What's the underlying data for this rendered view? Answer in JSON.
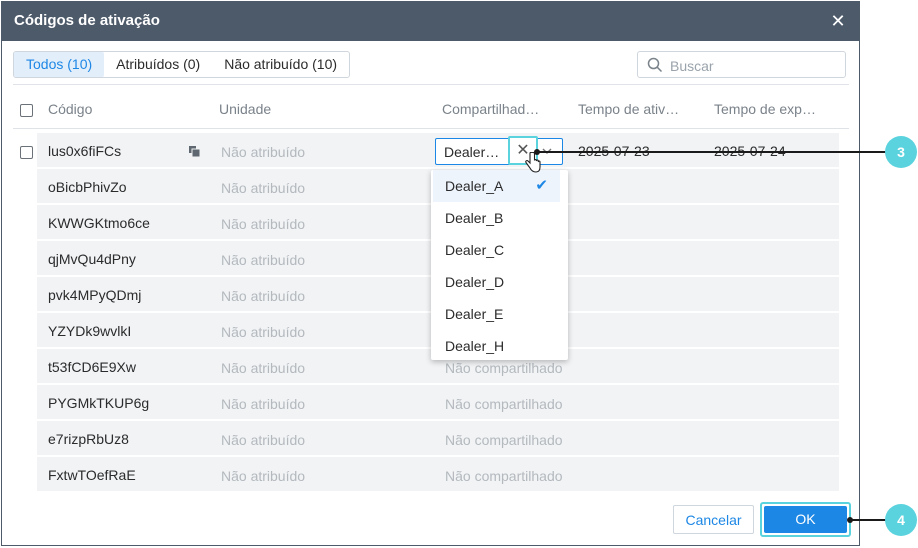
{
  "dialog": {
    "title": "Códigos de ativação"
  },
  "tabs": [
    {
      "label": "Todos (10)",
      "active": true
    },
    {
      "label": "Atribuídos (0)",
      "active": false
    },
    {
      "label": "Não atribuído (10)",
      "active": false
    }
  ],
  "search": {
    "placeholder": "Buscar",
    "value": ""
  },
  "columns": {
    "code": "Código",
    "unit": "Unidade",
    "shared": "Compartilhad…",
    "activation_time": "Tempo de ativ…",
    "expiration_time": "Tempo de exp…"
  },
  "rows": [
    {
      "code": "lus0x6fiFCs",
      "unit": "Não atribuído",
      "shared": "",
      "t1": "2025-07-23",
      "t2": "2025-07-24"
    },
    {
      "code": "oBicbPhivZo",
      "unit": "Não atribuído",
      "shared": "",
      "t1": "",
      "t2": ""
    },
    {
      "code": "KWWGKtmo6ce",
      "unit": "Não atribuído",
      "shared": "",
      "t1": "",
      "t2": ""
    },
    {
      "code": "qjMvQu4dPny",
      "unit": "Não atribuído",
      "shared": "",
      "t1": "",
      "t2": ""
    },
    {
      "code": "pvk4MPyQDmj",
      "unit": "Não atribuído",
      "shared": "",
      "t1": "",
      "t2": ""
    },
    {
      "code": "YZYDk9wvlkI",
      "unit": "Não atribuído",
      "shared": "",
      "t1": "",
      "t2": ""
    },
    {
      "code": "t53fCD6E9Xw",
      "unit": "Não atribuído",
      "shared": "Não compartilhado",
      "t1": "",
      "t2": ""
    },
    {
      "code": "PYGMkTKUP6g",
      "unit": "Não atribuído",
      "shared": "Não compartilhado",
      "t1": "",
      "t2": ""
    },
    {
      "code": "e7rizpRbUz8",
      "unit": "Não atribuído",
      "shared": "Não compartilhado",
      "t1": "",
      "t2": ""
    },
    {
      "code": "FxtwTOefRaE",
      "unit": "Não atribuído",
      "shared": "Não compartilhado",
      "t1": "",
      "t2": ""
    }
  ],
  "share_select": {
    "value": "Dealer…",
    "options": [
      "Dealer_A",
      "Dealer_B",
      "Dealer_C",
      "Dealer_D",
      "Dealer_E",
      "Dealer_H"
    ],
    "selected": "Dealer_A"
  },
  "footer": {
    "cancel_label": "Cancelar",
    "ok_label": "OK"
  },
  "callouts": {
    "c3": "3",
    "c4": "4"
  },
  "colors": {
    "accent": "#1d87e5",
    "titlebar": "#4d5a6a",
    "callout": "#5bd3de"
  }
}
